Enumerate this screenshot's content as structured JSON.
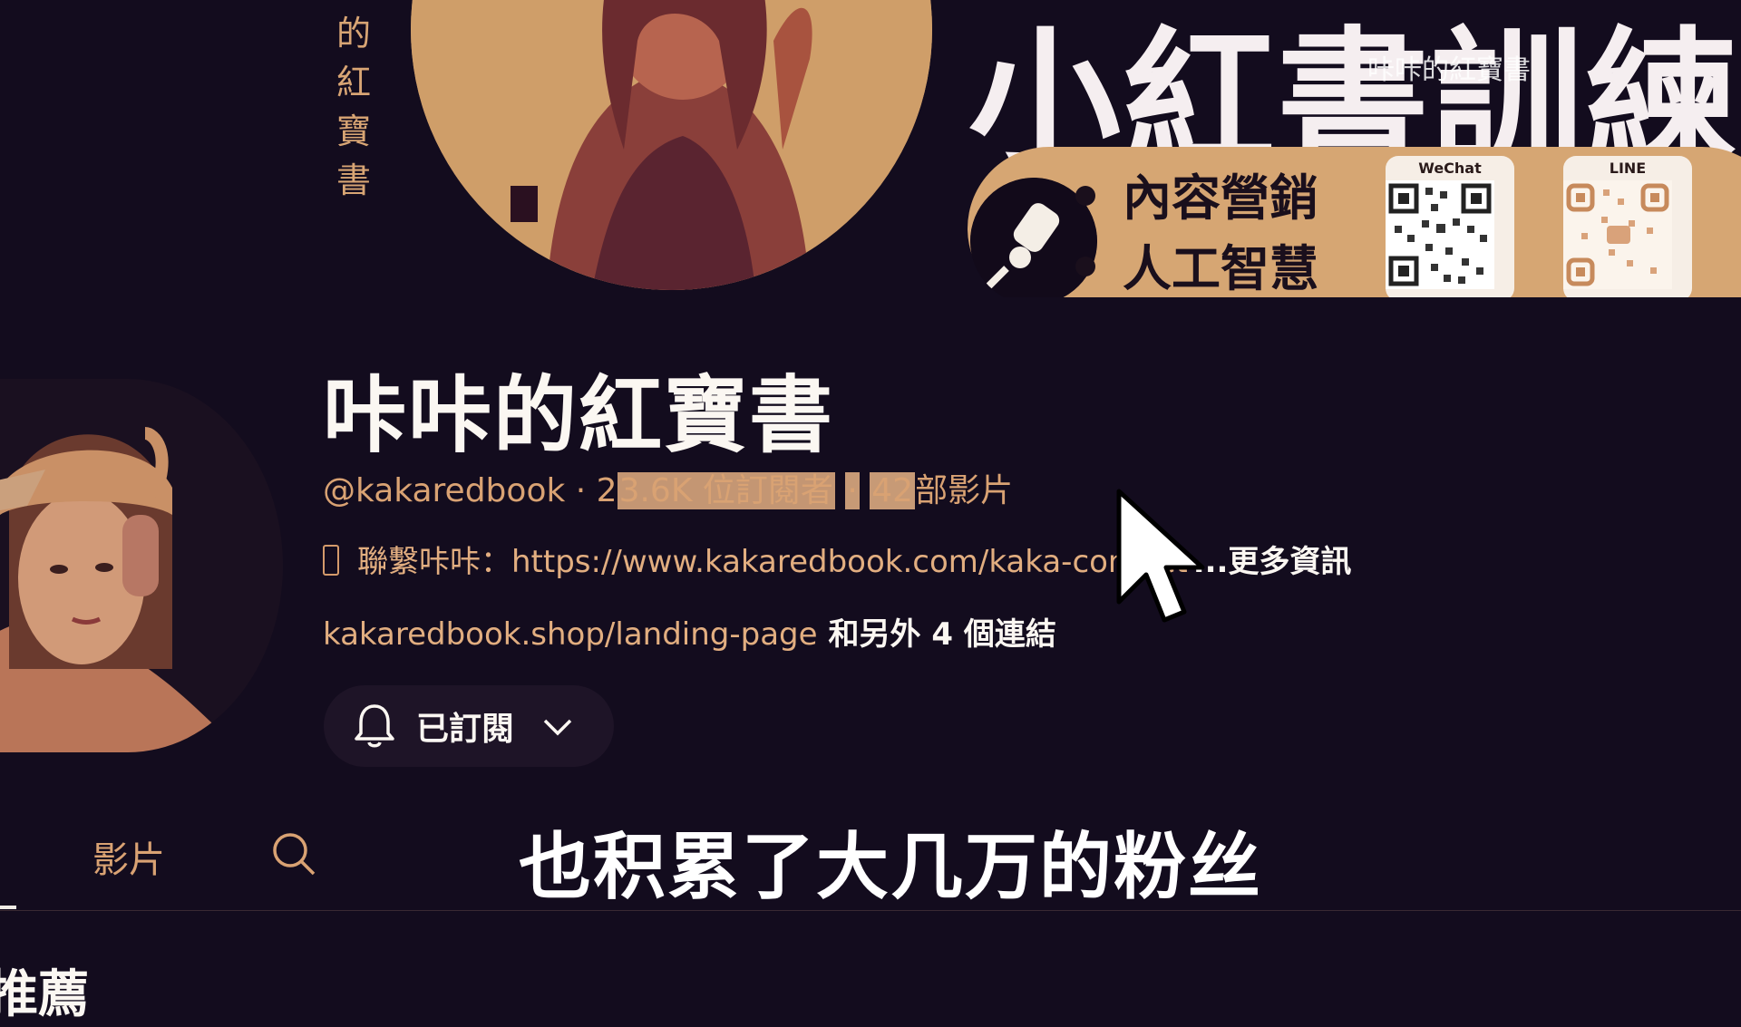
{
  "banner": {
    "vertical_text": [
      "的",
      "紅",
      "寶",
      "書"
    ],
    "title": "小紅書訓練",
    "watermark": "咔咔的紅寶書",
    "points": [
      "內容營銷",
      "人工智慧"
    ],
    "qr_codes": [
      {
        "label": "WeChat"
      },
      {
        "label": "LINE"
      }
    ]
  },
  "channel": {
    "name": "咔咔的紅寶書",
    "handle": "@kakaredbook",
    "separator": "·",
    "subscribers_prefix": "2",
    "subscribers_rest": "3.6K 位訂閱者",
    "videos_count": "42",
    "videos_label": "部影片",
    "description": "聯繫咔咔：https://www.kakaredbook.com/kaka-contact",
    "more_label": "...更多資訊",
    "link": "kakaredbook.shop/landing-page",
    "extra_links": "和另外 4 個連結",
    "subscribe_label": "已訂閱"
  },
  "tabs": {
    "videos_label": "影片"
  },
  "subtitle": "也积累了大几万的粉丝",
  "section_peek": "推薦",
  "colors": {
    "background": "#130c1e",
    "accent": "#d9a273",
    "banner_gold": "#d6a673"
  }
}
